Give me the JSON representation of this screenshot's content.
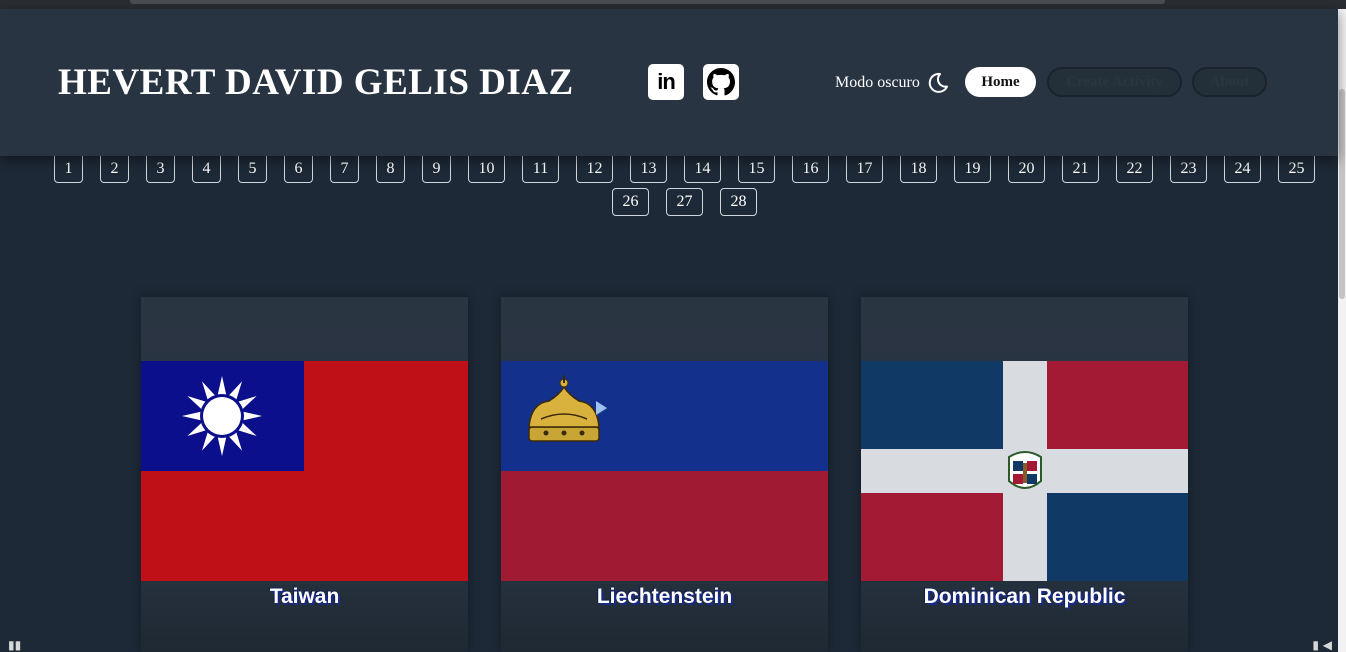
{
  "header": {
    "name": "HEVERT DAVID GELIS DIAZ",
    "linkedin_text": "in",
    "dark_mode_label": "Modo oscuro",
    "nav": {
      "home": "Home",
      "create": "Create Activity",
      "about": "About"
    }
  },
  "pagination": {
    "pages": [
      "1",
      "2",
      "3",
      "4",
      "5",
      "6",
      "7",
      "8",
      "9",
      "10",
      "11",
      "12",
      "13",
      "14",
      "15",
      "16",
      "17",
      "18",
      "19",
      "20",
      "21",
      "22",
      "23",
      "24",
      "25",
      "26",
      "27",
      "28"
    ]
  },
  "countries": [
    {
      "name": "Taiwan"
    },
    {
      "name": "Liechtenstein"
    },
    {
      "name": "Dominican Republic"
    }
  ],
  "colors": {
    "header_bg": "#283441",
    "page_bg": "#1d2936",
    "taiwan_red": "#be1016",
    "taiwan_blue": "#0b0f8c",
    "liechtenstein_blue": "#13308c",
    "liechtenstein_red": "#a11a34",
    "dr_blue": "#113966",
    "dr_red": "#a21a33"
  },
  "icons": [
    "linkedin-icon",
    "github-icon",
    "moon-icon",
    "crown-emblem",
    "sun-emblem",
    "coat-of-arms-emblem"
  ]
}
